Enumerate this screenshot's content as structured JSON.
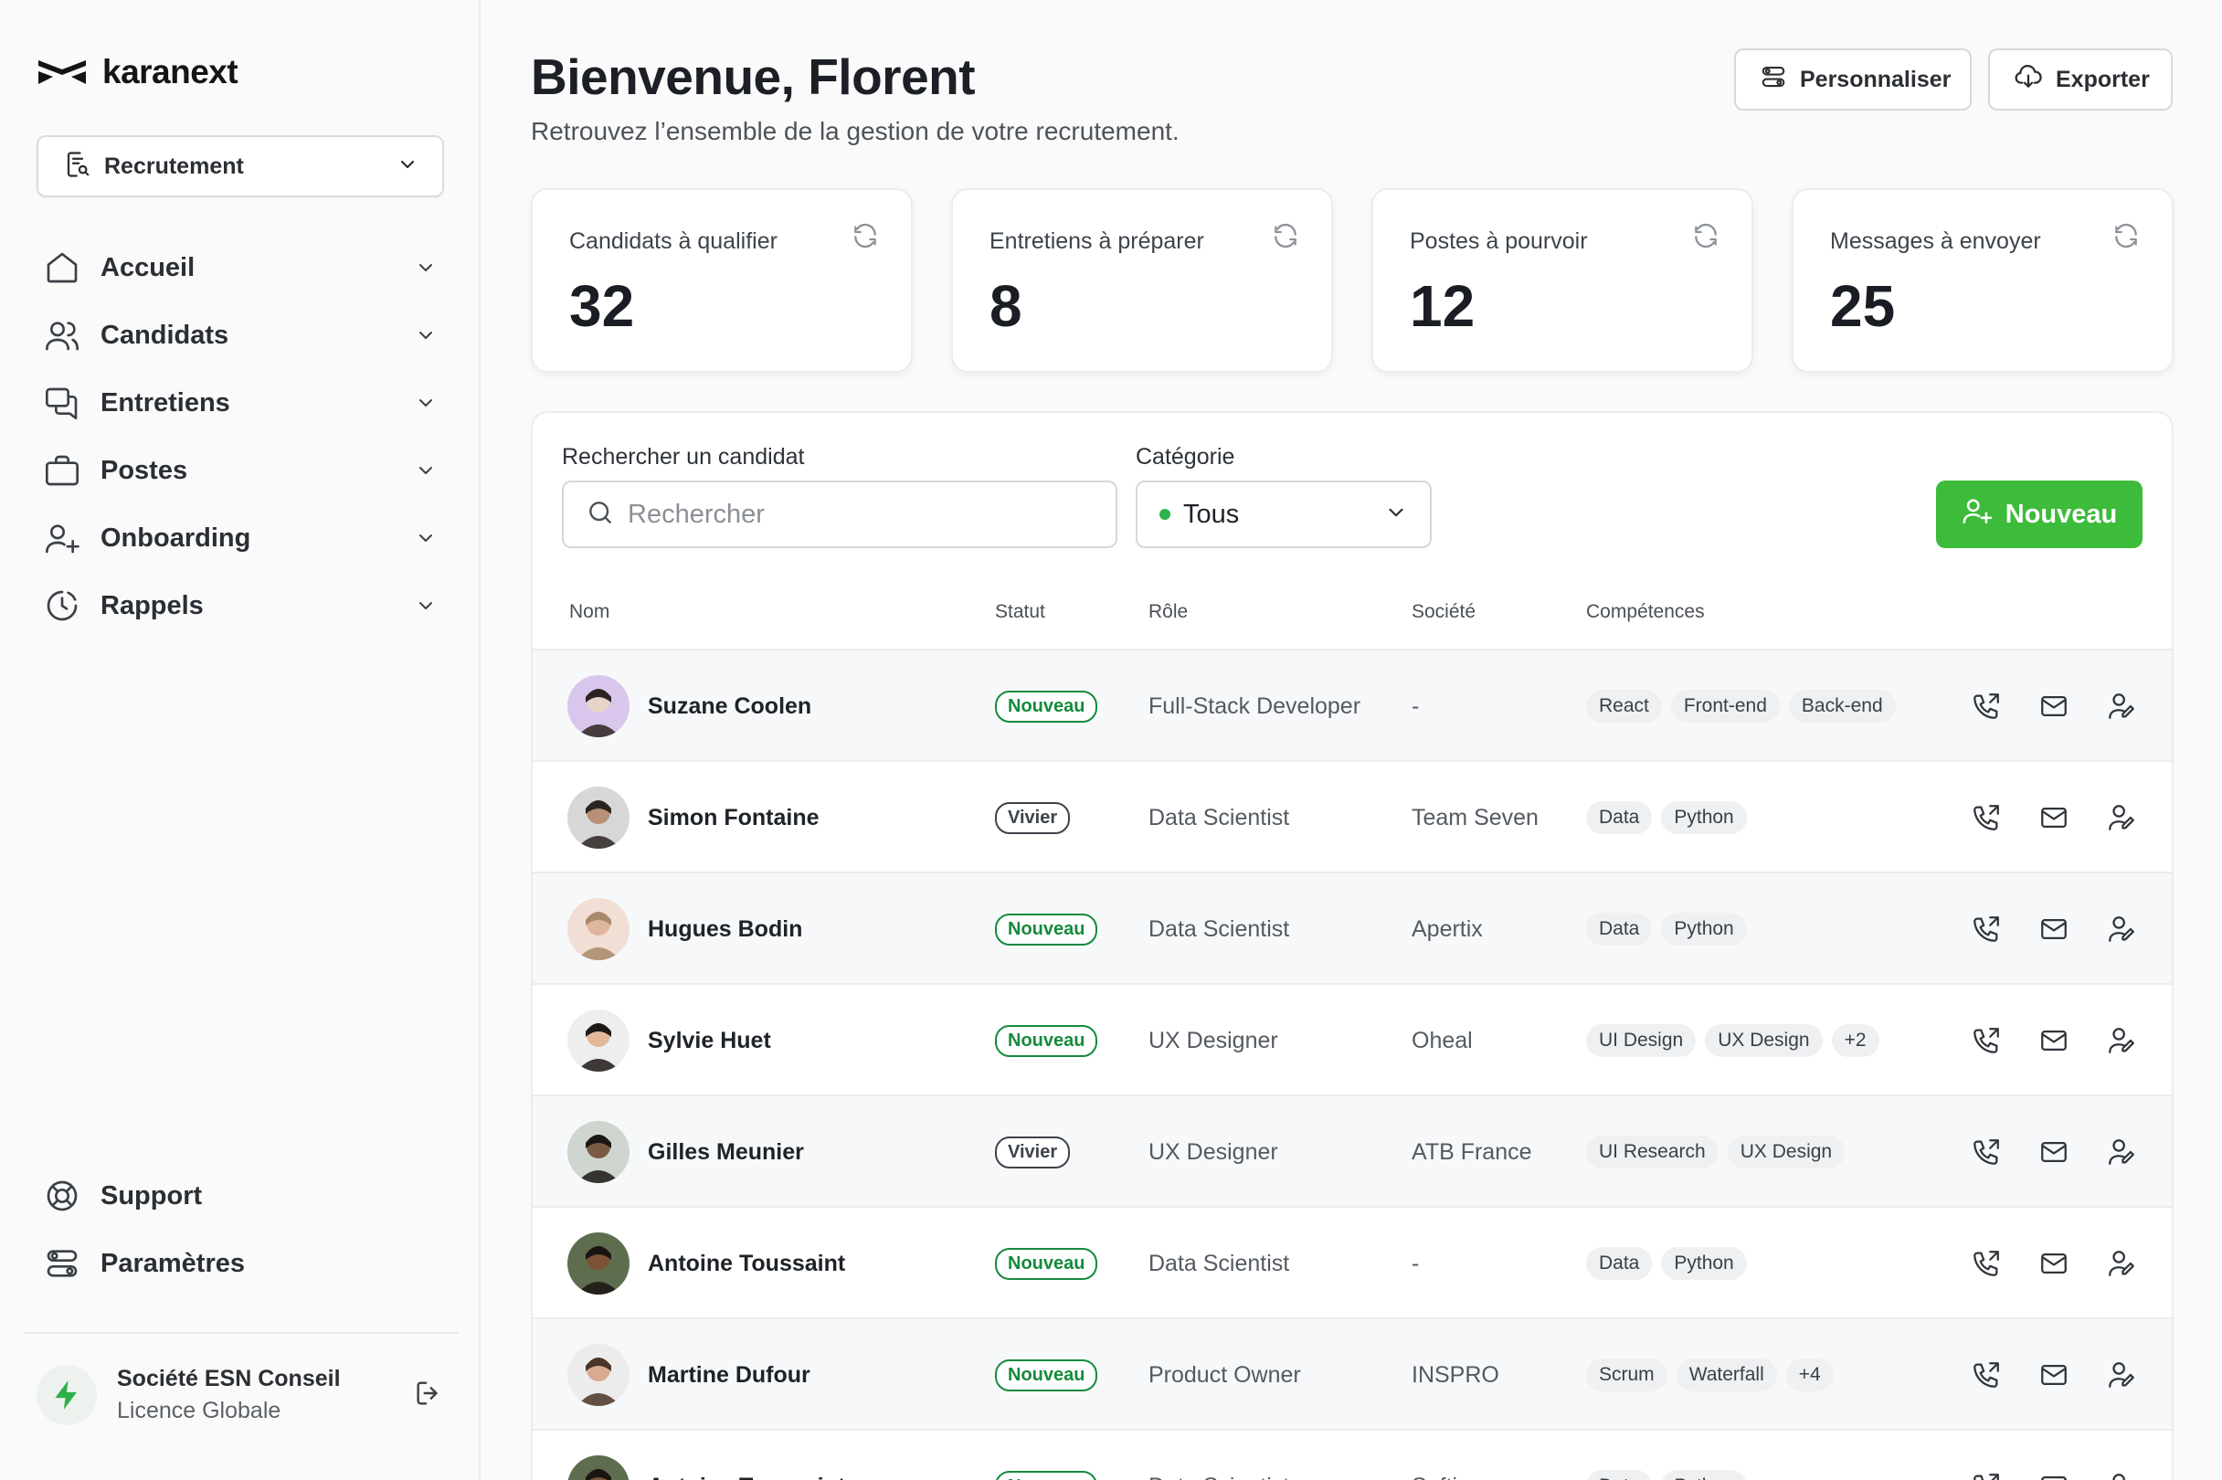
{
  "brand": {
    "name": "karanext"
  },
  "module_select": {
    "value": "Recrutement"
  },
  "nav": {
    "items": [
      {
        "label": "Accueil",
        "icon": "home-icon"
      },
      {
        "label": "Candidats",
        "icon": "users-icon"
      },
      {
        "label": "Entretiens",
        "icon": "chat-icon"
      },
      {
        "label": "Postes",
        "icon": "briefcase-icon"
      },
      {
        "label": "Onboarding",
        "icon": "user-plus-icon"
      },
      {
        "label": "Rappels",
        "icon": "clock-icon"
      }
    ],
    "bottom": [
      {
        "label": "Support",
        "icon": "lifebuoy-icon"
      },
      {
        "label": "Paramètres",
        "icon": "settings-icon"
      }
    ]
  },
  "org": {
    "name": "Société ESN Conseil",
    "license": "Licence Globale"
  },
  "header": {
    "title": "Bienvenue, Florent",
    "subtitle": "Retrouvez l’ensemble de la gestion de votre recrutement.",
    "customize_label": "Personnaliser",
    "export_label": "Exporter"
  },
  "stats": [
    {
      "label": "Candidats à qualifier",
      "value": "32"
    },
    {
      "label": "Entretiens à préparer",
      "value": "8"
    },
    {
      "label": "Postes à pourvoir",
      "value": "12"
    },
    {
      "label": "Messages à envoyer",
      "value": "25"
    }
  ],
  "filters": {
    "search_label": "Rechercher un candidat",
    "search_placeholder": "Rechercher",
    "category_label": "Catégorie",
    "category_value": "Tous",
    "new_button": "Nouveau"
  },
  "table": {
    "headers": {
      "name": "Nom",
      "status": "Statut",
      "role": "Rôle",
      "company": "Société",
      "skills": "Compétences"
    },
    "rows": [
      {
        "name": "Suzane Coolen",
        "status": "Nouveau",
        "role": "Full-Stack Developer",
        "company": "-",
        "skills": [
          "React",
          "Front-end",
          "Back-end"
        ]
      },
      {
        "name": "Simon Fontaine",
        "status": "Vivier",
        "role": "Data Scientist",
        "company": "Team Seven",
        "skills": [
          "Data",
          "Python"
        ]
      },
      {
        "name": "Hugues Bodin",
        "status": "Nouveau",
        "role": "Data Scientist",
        "company": "Apertix",
        "skills": [
          "Data",
          "Python"
        ]
      },
      {
        "name": "Sylvie Huet",
        "status": "Nouveau",
        "role": "UX Designer",
        "company": "Oheal",
        "skills": [
          "UI Design",
          "UX Design",
          "+2"
        ]
      },
      {
        "name": "Gilles Meunier",
        "status": "Vivier",
        "role": "UX Designer",
        "company": "ATB France",
        "skills": [
          "UI Research",
          "UX Design"
        ]
      },
      {
        "name": "Antoine Toussaint",
        "status": "Nouveau",
        "role": "Data Scientist",
        "company": "-",
        "skills": [
          "Data",
          "Python"
        ]
      },
      {
        "name": "Martine Dufour",
        "status": "Nouveau",
        "role": "Product Owner",
        "company": "INSPRO",
        "skills": [
          "Scrum",
          "Waterfall",
          "+4"
        ]
      },
      {
        "name": "Antoine Toussaint",
        "status": "Nouveau",
        "role": "Data Scientist",
        "company": "Softino",
        "skills": [
          "Data",
          "Python"
        ]
      }
    ]
  },
  "colors": {
    "accent_green": "#3dbb3a",
    "badge_green": "#158a3c",
    "text_dark": "#1e2328"
  }
}
